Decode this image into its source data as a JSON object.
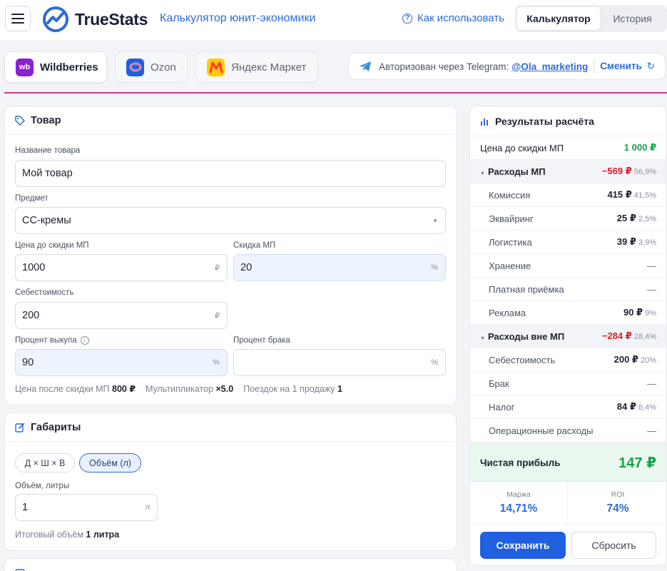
{
  "header": {
    "logo_text": "TrueStats",
    "subtitle": "Калькулятор юнит-экономики",
    "howto": "Как использовать",
    "tabs": [
      {
        "label": "Калькулятор",
        "active": true
      },
      {
        "label": "История",
        "active": false
      }
    ]
  },
  "marketplaces": [
    {
      "label": "Wildberries",
      "icon": "wb",
      "active": true
    },
    {
      "label": "Ozon",
      "active": false
    },
    {
      "label": "Яндекс Маркет",
      "active": false
    }
  ],
  "auth": {
    "text": "Авторизован через Telegram:",
    "handle": "@Ola_marketing",
    "change": "Сменить"
  },
  "product": {
    "title": "Товар",
    "name_label": "Название товара",
    "name_value": "Мой товар",
    "subject_label": "Предмет",
    "subject_value": "СС-кремы",
    "price_label": "Цена до скидки МП",
    "price_value": "1000",
    "price_unit": "₽",
    "discount_label": "Скидка МП",
    "discount_value": "20",
    "discount_unit": "%",
    "cost_label": "Себестоимость",
    "cost_value": "200",
    "cost_unit": "₽",
    "buyout_label": "Процент выкупа",
    "buyout_value": "90",
    "buyout_unit": "%",
    "defect_label": "Процент брака",
    "defect_value": "",
    "defect_unit": "%",
    "summary": {
      "price_after_label": "Цена после скидки МП",
      "price_after_value": "800 ₽",
      "mult_label": "Мультипликатор",
      "mult_value": "×5.0",
      "trips_label": "Поездок на 1 продажу",
      "trips_value": "1"
    }
  },
  "dims": {
    "title": "Габариты",
    "pill_dims": "Д × Ш × В",
    "pill_volume": "Объём (л)",
    "volume_label": "Объём, литры",
    "volume_value": "1",
    "volume_unit": "л",
    "total_label": "Итоговый объём",
    "total_value": "1 литра"
  },
  "results": {
    "title": "Результаты расчёта",
    "price_label": "Цена до скидки МП",
    "price_value": "1 000 ₽",
    "mp_group": {
      "label": "Расходы МП",
      "amount": "−569 ₽",
      "pct": "56,9%"
    },
    "mp_items": [
      {
        "label": "Комиссия",
        "amount": "415 ₽",
        "pct": "41,5%"
      },
      {
        "label": "Эквайринг",
        "amount": "25 ₽",
        "pct": "2,5%"
      },
      {
        "label": "Логистика",
        "amount": "39 ₽",
        "pct": "3,9%"
      },
      {
        "label": "Хранение",
        "amount": "—",
        "pct": ""
      },
      {
        "label": "Платная приёмка",
        "amount": "—",
        "pct": ""
      },
      {
        "label": "Реклама",
        "amount": "90 ₽",
        "pct": "9%"
      }
    ],
    "other_group": {
      "label": "Расходы вне МП",
      "amount": "−284 ₽",
      "pct": "28,4%"
    },
    "other_items": [
      {
        "label": "Себестоимость",
        "amount": "200 ₽",
        "pct": "20%"
      },
      {
        "label": "Брак",
        "amount": "—",
        "pct": ""
      },
      {
        "label": "Налог",
        "amount": "84 ₽",
        "pct": "8,4%"
      },
      {
        "label": "Операционные расходы",
        "amount": "—",
        "pct": ""
      }
    ],
    "net_label": "Чистая прибыль",
    "net_value": "147 ₽",
    "margin_label": "Маржа",
    "margin_value": "14,71%",
    "roi_label": "ROI",
    "roi_value": "74%",
    "save": "Сохранить",
    "reset": "Сбросить"
  },
  "colors": {
    "accent": "#2c6bd6",
    "positive": "#15a34a",
    "negative": "#d4222a",
    "divider": "#c43a8f"
  }
}
